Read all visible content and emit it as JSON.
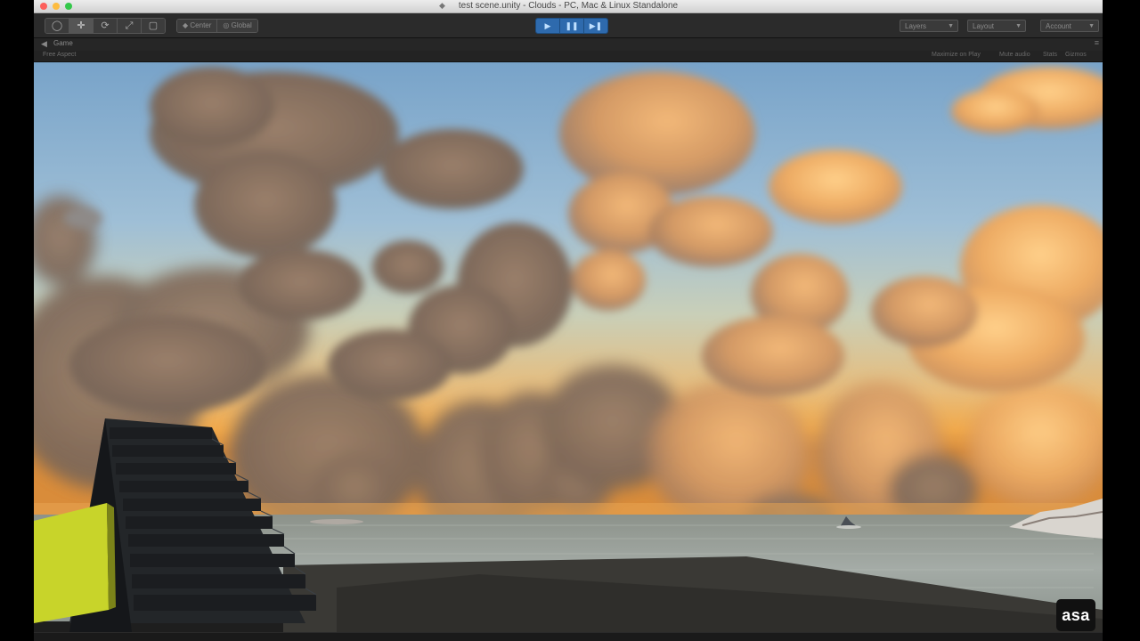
{
  "window": {
    "title": "test scene.unity - Clouds - PC, Mac & Linux Standalone",
    "title_icon": "unity-document-icon"
  },
  "toolbar": {
    "transform_tools": [
      {
        "name": "hand-tool-icon",
        "glyph": "✋"
      },
      {
        "name": "move-tool-icon",
        "glyph": "✛"
      },
      {
        "name": "rotate-tool-icon",
        "glyph": "⟳"
      },
      {
        "name": "scale-tool-icon",
        "glyph": "⤢"
      },
      {
        "name": "rect-tool-icon",
        "glyph": "▢"
      }
    ],
    "pivot_label": "Center",
    "global_label": "Global",
    "play_icons": [
      "play-icon",
      "pause-icon",
      "step-icon"
    ],
    "layers_label": "Layers",
    "layout_label": "Layout",
    "account_label": "Account"
  },
  "game_view": {
    "tab_label": "Game",
    "aspect_label": "Free Aspect",
    "maximize_label": "Maximize on Play",
    "mute_label": "Mute audio",
    "stats_label": "Stats",
    "gizmos_label": "Gizmos"
  },
  "watermark": {
    "text": "asa"
  },
  "colors": {
    "play_accent": "#2e6aad",
    "sky_top": "#7ea8cc",
    "horizon_glow": "#f0b15a",
    "water": "#9aa3a0",
    "yellow_block": "#c8d42a"
  }
}
